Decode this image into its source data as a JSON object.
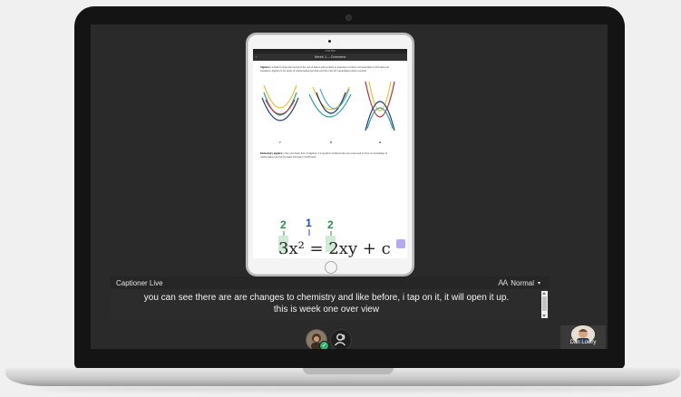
{
  "tablet": {
    "status_time": "1:52 PM",
    "nav_title": "Week 1 – Overview",
    "back_label": "‹",
    "intro_lead": "Algebra",
    "intro_text": " is a field of study that concerns the use of letters and symbols to represent numbers and quantities in formulas and equations. Algebra is the study of mathematical symbols and the rules for manipulating these symbols.",
    "graph_labels": [
      "c",
      "b",
      "a"
    ],
    "body_lead": "Elementary algebra",
    "body_text": " is the most basic form of algebra. It is taught to students who are presumed to have no knowledge of mathematics beyond the basic principles of arithmetic.",
    "eq_top": [
      "2",
      "1",
      "2"
    ],
    "eq_line": "3x² = 2xy + c"
  },
  "captions": {
    "title": "Captioner Live",
    "font_icon": "AA",
    "font_size_label": "Normal",
    "dropdown_arrow": "▾",
    "line1": "you can see there are are changes to chemistry and like before, i tap on it, it will open it up.",
    "line2": "this is week one over view"
  },
  "controls": {
    "check": "✓"
  },
  "participant": {
    "name": "Dan Lowry"
  },
  "colors": {
    "curve_yellow": "#e3c43a",
    "curve_teal": "#2f9f9a",
    "curve_navy": "#1f3b73",
    "curve_red": "#b8323a",
    "curve_blue": "#5aa6d8",
    "eq_green": "#2f8f4e",
    "eq_blue": "#2145c9"
  }
}
